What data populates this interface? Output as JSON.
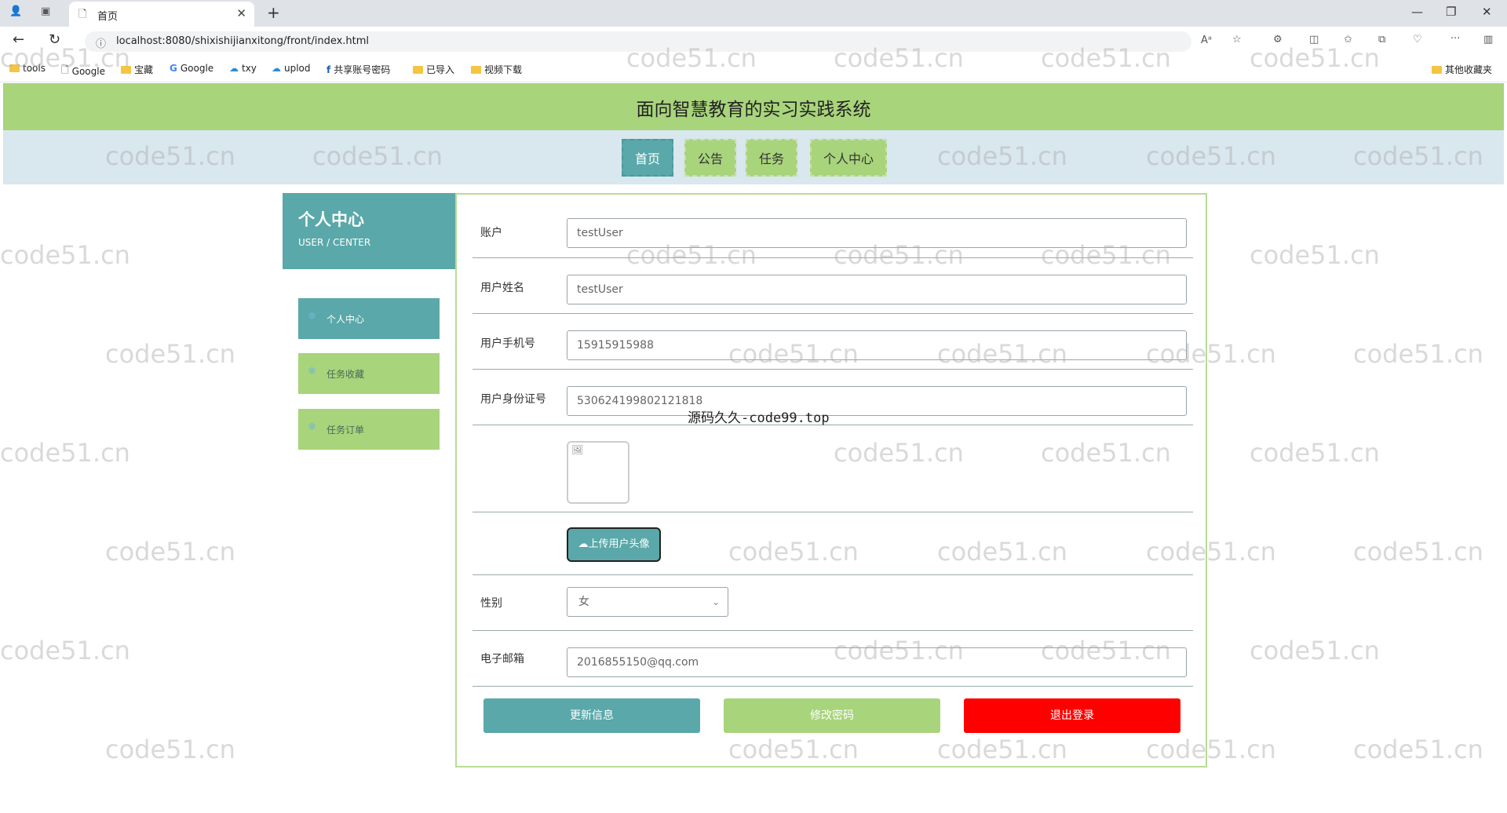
{
  "browser": {
    "tab_title": "首页",
    "url": "localhost:8080/shixishijianxitong/front/index.html",
    "bookmarks": [
      {
        "label": "tools",
        "icon": "folder-icon"
      },
      {
        "label": "Google",
        "icon": "page-icon"
      },
      {
        "label": "宝藏",
        "icon": "folder-icon"
      },
      {
        "label": "Google",
        "icon": "google-icon"
      },
      {
        "label": "txy",
        "icon": "cloud-icon"
      },
      {
        "label": "uplod",
        "icon": "cloud-icon"
      },
      {
        "label": "共享账号密码",
        "icon": "app-icon"
      },
      {
        "label": "已导入",
        "icon": "folder-icon"
      },
      {
        "label": "视频下载",
        "icon": "folder-icon"
      }
    ],
    "other_bookmarks": "其他收藏夹"
  },
  "site": {
    "title": "面向智慧教育的实习实践系统",
    "nav": [
      "首页",
      "公告",
      "任务",
      "个人中心"
    ]
  },
  "user_center": {
    "title": "个人中心",
    "subtitle": "USER / CENTER",
    "menu": [
      "个人中心",
      "任务收藏",
      "任务订单"
    ]
  },
  "form": {
    "account_label": "账户",
    "account_value": "testUser",
    "name_label": "用户姓名",
    "name_value": "testUser",
    "phone_label": "用户手机号",
    "phone_value": "15915915988",
    "idcard_label": "用户身份证号",
    "idcard_value": "530624199802121818",
    "upload_label": "上传用户头像",
    "gender_label": "性别",
    "gender_value": "女",
    "email_label": "电子邮箱",
    "email_value": "2016855150@qq.com",
    "update_button": "更新信息",
    "password_button": "修改密码",
    "logout_button": "退出登录"
  },
  "overlay_text": "源码久久-code99.top",
  "watermark": "code51.cn",
  "colors": {
    "header_green": "#a8d47b",
    "teal": "#5aa8a9",
    "nav_bg": "#d9e7ef",
    "logout_red": "#ff0000"
  }
}
